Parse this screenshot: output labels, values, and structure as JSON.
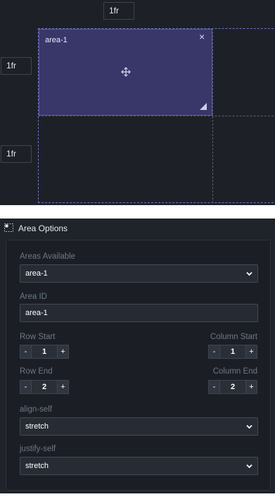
{
  "editor": {
    "column_tracks": [
      "1fr"
    ],
    "row_tracks": [
      "1fr",
      "1fr"
    ],
    "area": {
      "name": "area-1",
      "close_glyph": "×",
      "move_icon": "move-icon",
      "resize_icon": "resize-handle-icon"
    },
    "colors": {
      "background": "#1d2127",
      "area_fill": "#393669",
      "area_border": "#6e72c9"
    }
  },
  "panel": {
    "title": "Area Options",
    "icon": "grid-area-icon",
    "areas_available": {
      "label": "Areas Available",
      "value": "area-1"
    },
    "area_id": {
      "label": "Area ID",
      "value": "area-1"
    },
    "row_start": {
      "label": "Row Start",
      "value": "1"
    },
    "column_start": {
      "label": "Column Start",
      "value": "1"
    },
    "row_end": {
      "label": "Row End",
      "value": "2"
    },
    "column_end": {
      "label": "Column End",
      "value": "2"
    },
    "align_self": {
      "label": "align-self",
      "value": "stretch"
    },
    "justify_self": {
      "label": "justify-self",
      "value": "stretch"
    },
    "stepper_minus": "-",
    "stepper_plus": "+"
  }
}
